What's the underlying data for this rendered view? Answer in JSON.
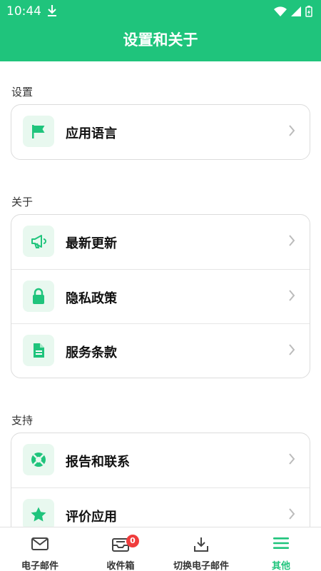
{
  "status": {
    "time": "10:44"
  },
  "header": {
    "title": "设置和关于"
  },
  "sections": [
    {
      "title": "设置",
      "items": [
        {
          "label": "应用语言",
          "icon": "flag-icon"
        }
      ]
    },
    {
      "title": "关于",
      "items": [
        {
          "label": "最新更新",
          "icon": "megaphone-icon"
        },
        {
          "label": "隐私政策",
          "icon": "lock-icon"
        },
        {
          "label": "服务条款",
          "icon": "document-icon"
        }
      ]
    },
    {
      "title": "支持",
      "items": [
        {
          "label": "报告和联系",
          "icon": "lifebuoy-icon"
        },
        {
          "label": "评价应用",
          "icon": "star-icon"
        }
      ]
    }
  ],
  "tabbar": {
    "tabs": [
      {
        "label": "电子邮件",
        "icon": "mail-icon"
      },
      {
        "label": "收件箱",
        "icon": "inbox-icon",
        "badge": "0"
      },
      {
        "label": "切换电子邮件",
        "icon": "download-icon"
      },
      {
        "label": "其他",
        "icon": "menu-icon",
        "active": true
      }
    ]
  },
  "colors": {
    "accent": "#1fc47c",
    "icon_bg": "#e8f8ef",
    "badge": "#f03c3c"
  }
}
